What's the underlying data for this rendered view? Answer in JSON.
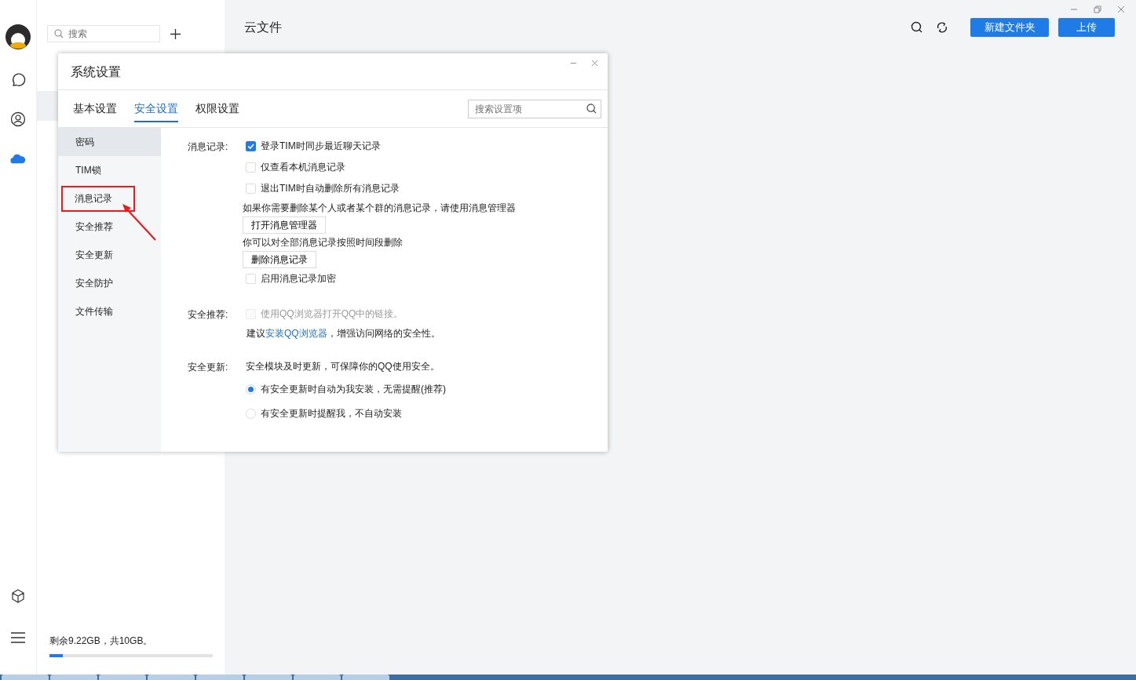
{
  "search": {
    "placeholder": "搜索"
  },
  "storage": {
    "text": "剩余9.22GB，共10GB。",
    "level": 0.08
  },
  "main": {
    "title": "云文件",
    "buttons": [
      "新建文件夹",
      "上传"
    ]
  },
  "dialog": {
    "title": "系统设置",
    "tabs": [
      {
        "label": "基本设置",
        "selected": false
      },
      {
        "label": "安全设置",
        "selected": true
      },
      {
        "label": "权限设置",
        "selected": false
      }
    ],
    "search": {
      "placeholder": "搜索设置项"
    },
    "nav": [
      {
        "label": "密码",
        "selected": true,
        "annotated": false
      },
      {
        "label": "TIM锁",
        "selected": false,
        "annotated": false
      },
      {
        "label": "消息记录",
        "selected": false,
        "annotated": true
      },
      {
        "label": "安全推荐",
        "selected": false,
        "annotated": false
      },
      {
        "label": "安全更新",
        "selected": false,
        "annotated": false
      },
      {
        "label": "安全防护",
        "selected": false,
        "annotated": false
      },
      {
        "label": "文件传输",
        "selected": false,
        "annotated": false
      }
    ],
    "sections": [
      {
        "label": "消息记录:",
        "items": [
          {
            "kind": "checkbox",
            "text": "登录TIM时同步最近聊天记录",
            "checked": true,
            "disabled": false
          },
          {
            "kind": "checkbox",
            "text": "仅查看本机消息记录",
            "checked": false,
            "disabled": false
          },
          {
            "kind": "checkbox",
            "text": "退出TIM时自动删除所有消息记录",
            "checked": false,
            "disabled": false
          },
          {
            "kind": "note",
            "text": "如果你需要删除某个人或者某个群的消息记录，请使用消息管理器"
          },
          {
            "kind": "button",
            "text": "打开消息管理器"
          },
          {
            "kind": "note",
            "text": "你可以对全部消息记录按照时间段删除"
          },
          {
            "kind": "button",
            "text": "删除消息记录"
          },
          {
            "kind": "checkbox",
            "text": "启用消息记录加密",
            "checked": false,
            "disabled": false
          }
        ]
      },
      {
        "label": "安全推荐:",
        "items": [
          {
            "kind": "checkbox",
            "text": "使用QQ浏览器打开QQ中的链接。",
            "checked": false,
            "disabled": true
          },
          {
            "kind": "link_note",
            "before": "建议",
            "link": "安装QQ浏览器",
            "after": "，增强访问网络的安全性。"
          }
        ]
      },
      {
        "label": "安全更新:",
        "items": [
          {
            "kind": "note",
            "text": "安全模块及时更新，可保障你的QQ使用安全。"
          },
          {
            "kind": "radio",
            "text": "有安全更新时自动为我安装，无需提醒(推荐)",
            "selected": true
          },
          {
            "kind": "radio",
            "text": "有安全更新时提醒我，不自动安装",
            "selected": false
          }
        ]
      }
    ]
  }
}
